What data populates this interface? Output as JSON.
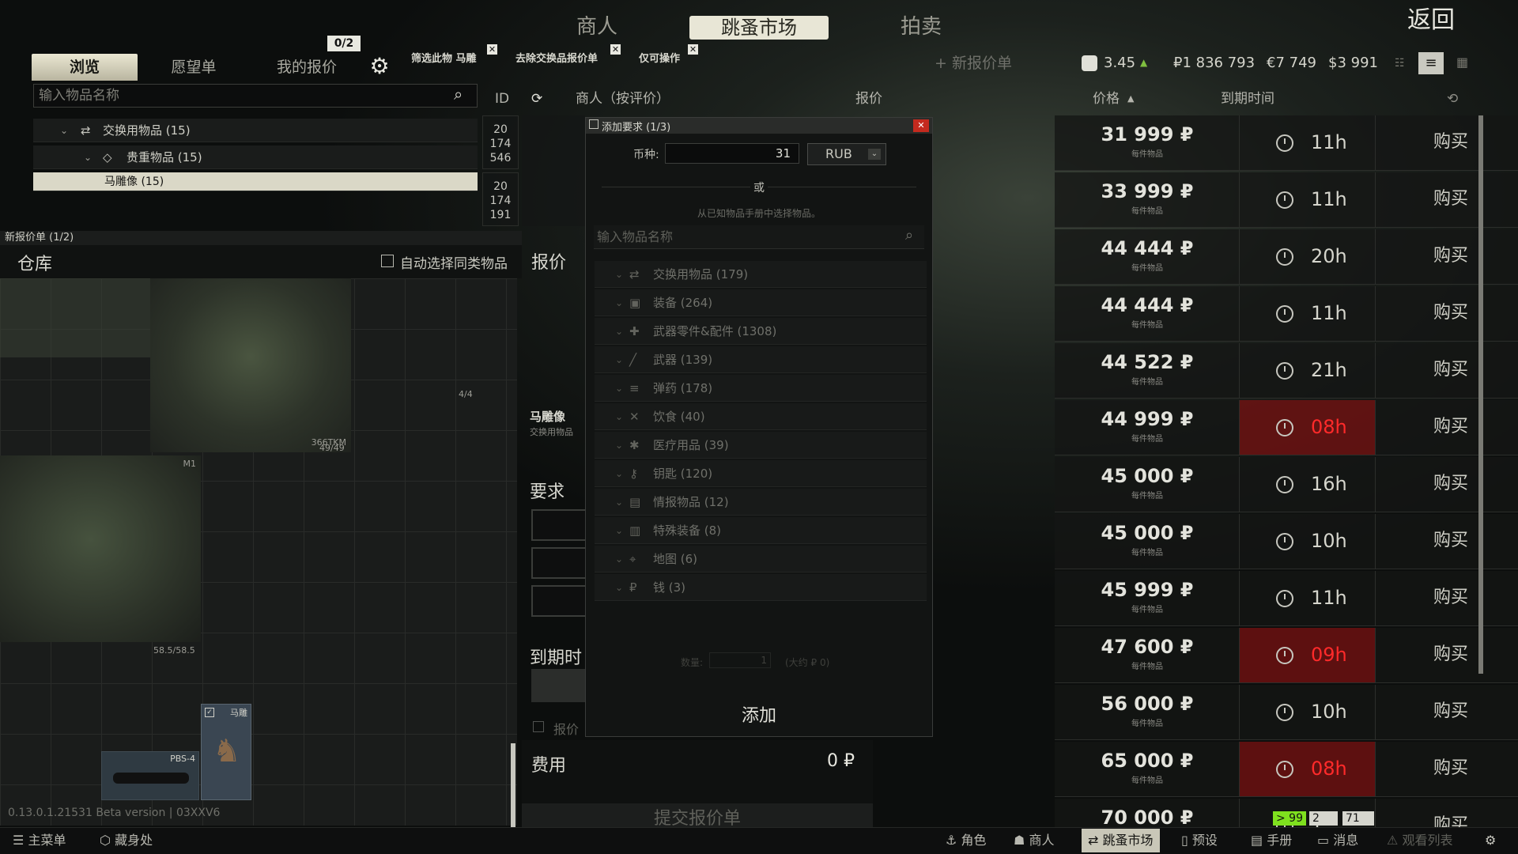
{
  "top_tabs": {
    "traders": "商人",
    "flea": "跳蚤市场",
    "auction": "拍卖",
    "back": "返回"
  },
  "sub_tabs": {
    "browse": "浏览",
    "wishlist": "愿望单",
    "my_offers": "我的报价",
    "my_offers_count": "0/2"
  },
  "filters": {
    "chip1": "筛选此物 马雕",
    "chip2": "去除交换品报价单",
    "chip3": "仅可操作",
    "new_offer": "+ 新报价单"
  },
  "currency": {
    "rating": "3.45",
    "rub": "₽1 836 793",
    "eur": "€7 749",
    "usd": "$3 991"
  },
  "search": {
    "placeholder": "输入物品名称"
  },
  "tree": {
    "barter": "交换用物品 (15)",
    "valuables": "贵重物品 (15)",
    "selected": "马雕像 (15)"
  },
  "columns": {
    "id": "ID",
    "seller": "商人（按评价）",
    "offer": "报价",
    "price": "价格",
    "expire": "到期时间"
  },
  "left_ids": [
    [
      "20",
      "174",
      "546"
    ],
    [
      "20",
      "174",
      "191"
    ]
  ],
  "new_offer_panel": {
    "title": "新报价单 (1/2)",
    "stash": "仓库",
    "auto_select": "自动选择同类物品",
    "offer": "报价",
    "item_name": "马雕像",
    "item_type": "交换用物品",
    "requirements": "要求",
    "expire": "到期时",
    "offer_check": "报价",
    "fee": "费用",
    "fee_value": "0 ₽",
    "submit": "提交报价单",
    "version": "0.13.0.1.21531 Beta version | 03XXV6"
  },
  "stash_items": {
    "armor_tag1": "366TKM",
    "armor_count1": "4/4",
    "dur1": "49/49",
    "m1": "M1",
    "dur2": "58.5/58.5",
    "pbs4": "PBS-4",
    "horse": "马雕"
  },
  "dialog": {
    "title": "添加要求 (1/3)",
    "currency_label": "币种:",
    "currency_value": "31",
    "currency_select": "RUB",
    "or": "或",
    "choose": "从已知物品手册中选择物品。",
    "search_placeholder": "输入物品名称",
    "qty_label": "数量:",
    "qty_value": "1",
    "approx": "(大约 ₽ 0)",
    "add": "添加",
    "categories": [
      {
        "icon": "⇄",
        "label": "交换用物品 (179)"
      },
      {
        "icon": "▣",
        "label": "装备 (264)"
      },
      {
        "icon": "✚",
        "label": "武器零件&配件 (1308)"
      },
      {
        "icon": "╱",
        "label": "武器 (139)"
      },
      {
        "icon": "≡",
        "label": "弹药 (178)"
      },
      {
        "icon": "✕",
        "label": "饮食 (40)"
      },
      {
        "icon": "✱",
        "label": "医疗用品 (39)"
      },
      {
        "icon": "⚷",
        "label": "钥匙 (120)"
      },
      {
        "icon": "▤",
        "label": "情报物品 (12)"
      },
      {
        "icon": "▥",
        "label": "特殊装备 (8)"
      },
      {
        "icon": "⌖",
        "label": "地图 (6)"
      },
      {
        "icon": "₽",
        "label": "钱 (3)"
      }
    ]
  },
  "offers": [
    {
      "price": "31 999 ₽",
      "sub": "每件物品",
      "time": "11h",
      "red": false,
      "buy": "购买"
    },
    {
      "price": "33 999 ₽",
      "sub": "每件物品",
      "time": "11h",
      "red": false,
      "buy": "购买"
    },
    {
      "price": "44 444 ₽",
      "sub": "每件物品",
      "time": "20h",
      "red": false,
      "buy": "购买"
    },
    {
      "price": "44 444 ₽",
      "sub": "每件物品",
      "time": "11h",
      "red": false,
      "buy": "购买"
    },
    {
      "price": "44 522 ₽",
      "sub": "每件物品",
      "time": "21h",
      "red": false,
      "buy": "购买"
    },
    {
      "price": "44 999 ₽",
      "sub": "每件物品",
      "time": "08h",
      "red": true,
      "buy": "购买"
    },
    {
      "price": "45 000 ₽",
      "sub": "每件物品",
      "time": "16h",
      "red": false,
      "buy": "购买"
    },
    {
      "price": "45 000 ₽",
      "sub": "每件物品",
      "time": "10h",
      "red": false,
      "buy": "购买"
    },
    {
      "price": "45 999 ₽",
      "sub": "每件物品",
      "time": "11h",
      "red": false,
      "buy": "购买"
    },
    {
      "price": "47 600 ₽",
      "sub": "每件物品",
      "time": "09h",
      "red": true,
      "buy": "购买"
    },
    {
      "price": "56 000 ₽",
      "sub": "每件物品",
      "time": "10h",
      "red": false,
      "buy": "购买"
    },
    {
      "price": "65 000 ₽",
      "sub": "每件物品",
      "time": "08h",
      "red": true,
      "buy": "购买"
    },
    {
      "price": "70 000 ₽",
      "sub": "",
      "time": "1",
      "red": false,
      "buy": "购买"
    }
  ],
  "status_badges": {
    "b1": "> 99",
    "b2": "2",
    "b3": "71"
  },
  "bottom_bar": {
    "menu": "主菜单",
    "hideout": "藏身处",
    "character": "角色",
    "traders": "商人",
    "flea": "跳蚤市场",
    "presets": "预设",
    "handbook": "手册",
    "messages": "消息",
    "watchlist": "观看列表"
  },
  "colors": {
    "accent": "#e8e6d6",
    "expire_red": "#ff2a2a",
    "badge_green": "#7fe11e"
  }
}
